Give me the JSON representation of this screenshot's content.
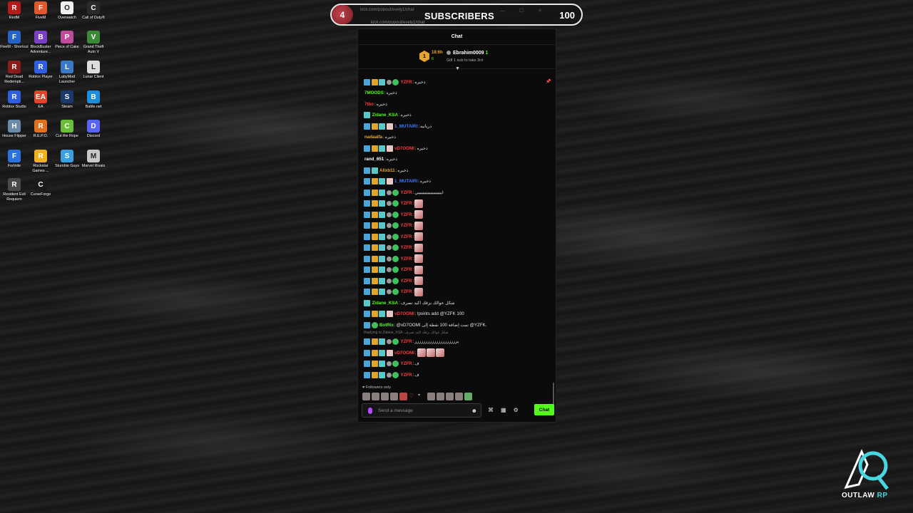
{
  "desktop_icons": [
    {
      "label": "RedM",
      "icon": "redm-icon",
      "color": "#b41c1c",
      "glyph": "R"
    },
    {
      "label": "FiveM",
      "icon": "fivem-icon",
      "color": "#e0592a",
      "glyph": "F"
    },
    {
      "label": "Overwatch",
      "icon": "overwatch-icon",
      "color": "#f0f0f0",
      "glyph": "O"
    },
    {
      "label": "Call of Duty®",
      "icon": "call-of-duty-icon",
      "color": "#2a2a2a",
      "glyph": "C"
    },
    {
      "label": "FiveM - Shortcut",
      "icon": "fivem-shortcut-icon",
      "color": "#2264c7",
      "glyph": "F"
    },
    {
      "label": "BlockBuster Adventure...",
      "icon": "blockbuster-icon",
      "color": "#7a3fc4",
      "glyph": "B"
    },
    {
      "label": "Piece of Cake",
      "icon": "piece-of-cake-icon",
      "color": "#c04a9b",
      "glyph": "P"
    },
    {
      "label": "Grand Theft Auto V",
      "icon": "gta-icon",
      "color": "#3a8a3a",
      "glyph": "V"
    },
    {
      "label": "Red Dead Redempti...",
      "icon": "red-dead-icon",
      "color": "#8c1b1b",
      "glyph": "R"
    },
    {
      "label": "Roblox Player",
      "icon": "roblox-player-icon",
      "color": "#2f5fe0",
      "glyph": "R"
    },
    {
      "label": "LabyMod Launcher",
      "icon": "labymod-icon",
      "color": "#3a78c8",
      "glyph": "L"
    },
    {
      "label": "Lunar Client",
      "icon": "lunar-client-icon",
      "color": "#dcdcdc",
      "glyph": "L"
    },
    {
      "label": "Roblox Studio",
      "icon": "roblox-studio-icon",
      "color": "#2f5fe0",
      "glyph": "R"
    },
    {
      "label": "EA",
      "icon": "ea-icon",
      "color": "#e0452a",
      "glyph": "EA"
    },
    {
      "label": "Steam",
      "icon": "steam-icon",
      "color": "#1b3a6b",
      "glyph": "S"
    },
    {
      "label": "Battle.net",
      "icon": "battlenet-icon",
      "color": "#1c8ee0",
      "glyph": "B"
    },
    {
      "label": "House Flipper",
      "icon": "house-flipper-icon",
      "color": "#6a8aa8",
      "glyph": "H"
    },
    {
      "label": "R.E.P.O.",
      "icon": "repo-icon",
      "color": "#e07020",
      "glyph": "R"
    },
    {
      "label": "Cut the Rope",
      "icon": "cut-the-rope-icon",
      "color": "#6abf3a",
      "glyph": "C"
    },
    {
      "label": "Discord",
      "icon": "discord-icon",
      "color": "#5865f2",
      "glyph": "D"
    },
    {
      "label": "Fortnite",
      "icon": "fortnite-icon",
      "color": "#2a72e0",
      "glyph": "F"
    },
    {
      "label": "Rockstar Games ...",
      "icon": "rockstar-icon",
      "color": "#f0b020",
      "glyph": "R"
    },
    {
      "label": "Stumble Guys",
      "icon": "stumble-guys-icon",
      "color": "#3aa0e0",
      "glyph": "S"
    },
    {
      "label": "Marvel Rivals",
      "icon": "marvel-rivals-icon",
      "color": "#c8c8c8",
      "glyph": "M"
    },
    {
      "label": "Resident Evil Requiem",
      "icon": "resident-evil-icon",
      "color": "#4a4a4a",
      "glyph": "R"
    },
    {
      "label": "CurseForge",
      "icon": "curseforge-icon",
      "color": "#1a1a1a",
      "glyph": "C"
    }
  ],
  "subscribers": {
    "count": "4",
    "label": "SUBSCRIBERS",
    "goal": "100",
    "url": "kick.com/popout/evely1/chat",
    "url_bar": "kick.com/popout/evely1/chat"
  },
  "chat": {
    "title": "Chat",
    "pinned": {
      "rank": "1",
      "time": "18:6h",
      "sub_count": "6",
      "user": "Ebrahim0009",
      "user_badge": "1",
      "gift_text": "Gift 1 sub to take 3rd"
    },
    "messages": [
      {
        "badges": [
          "blue",
          "gold",
          "teal",
          "gray",
          "green"
        ],
        "user": "YZFR",
        "color": "#ff3b3b",
        "text": "ذخيره"
      },
      {
        "badges": [],
        "user": "7MOODS",
        "color": "#53fc18",
        "text": "ذخيره"
      },
      {
        "badges": [],
        "user": "7tbo",
        "color": "#ff3b3b",
        "text": "ذخيره"
      },
      {
        "badges": [
          "teal"
        ],
        "user": "Zidane_KSA",
        "color": "#53fc18",
        "text": "ذخيره"
      },
      {
        "badges": [
          "blue",
          "gold",
          "teal",
          "pink"
        ],
        "user": "1_MUTAIRI",
        "color": "#3a7bff",
        "text": "ذريانيه"
      },
      {
        "badges": [],
        "user": "nadaalfa",
        "color": "#e4a62f",
        "text": "ذخيره"
      },
      {
        "badges": [
          "blue",
          "gold",
          "teal",
          "pink"
        ],
        "user": "vD7OOMI",
        "color": "#ff3b3b",
        "text": "ذخيره"
      },
      {
        "badges": [],
        "user": "rand_651",
        "color": "#ffffff",
        "text": "ذخيره"
      },
      {
        "badges": [
          "blue",
          "teal"
        ],
        "user": "Alixb11",
        "color": "#e4a62f",
        "text": "ذخيره"
      },
      {
        "badges": [
          "blue",
          "gold",
          "teal",
          "pink"
        ],
        "user": "1_MUTAIRI",
        "color": "#3a7bff",
        "text": "ذخيره"
      },
      {
        "badges": [
          "blue",
          "gold",
          "teal",
          "gray",
          "green"
        ],
        "user": "YZFR",
        "color": "#ff3b3b",
        "text": "اييييييييييييييييييي"
      },
      {
        "badges": [
          "blue",
          "gold",
          "teal",
          "gray",
          "green"
        ],
        "user": "YZFR",
        "color": "#ff3b3b",
        "text": "",
        "emote": true
      },
      {
        "badges": [
          "blue",
          "gold",
          "teal",
          "gray",
          "green"
        ],
        "user": "YZFR",
        "color": "#ff3b3b",
        "text": "",
        "emote": true
      },
      {
        "badges": [
          "blue",
          "gold",
          "teal",
          "gray",
          "green"
        ],
        "user": "YZFR",
        "color": "#ff3b3b",
        "text": "",
        "emote": true
      },
      {
        "badges": [
          "blue",
          "gold",
          "teal",
          "gray",
          "green"
        ],
        "user": "YZFR",
        "color": "#ff3b3b",
        "text": "",
        "emote": true
      },
      {
        "badges": [
          "blue",
          "gold",
          "teal",
          "gray",
          "green"
        ],
        "user": "YZFR",
        "color": "#ff3b3b",
        "text": "",
        "emote": true
      },
      {
        "badges": [
          "blue",
          "gold",
          "teal",
          "gray",
          "green"
        ],
        "user": "YZFR",
        "color": "#ff3b3b",
        "text": "",
        "emote": true
      },
      {
        "badges": [
          "blue",
          "gold",
          "teal",
          "gray",
          "green"
        ],
        "user": "YZFR",
        "color": "#ff3b3b",
        "text": "",
        "emote": true
      },
      {
        "badges": [
          "blue",
          "gold",
          "teal",
          "gray",
          "green"
        ],
        "user": "YZFR",
        "color": "#ff3b3b",
        "text": "",
        "emote": true
      },
      {
        "badges": [
          "blue",
          "gold",
          "teal",
          "gray",
          "green"
        ],
        "user": "YZFR",
        "color": "#ff3b3b",
        "text": "",
        "emote": true
      },
      {
        "badges": [
          "teal"
        ],
        "user": "Zidane_KSA",
        "color": "#53fc18",
        "text": "شكل عوالك بزقك اكيد تصرف"
      },
      {
        "badges": [
          "blue",
          "gold",
          "teal",
          "pink"
        ],
        "user": "vD7OOMI",
        "color": "#ff3b3b",
        "text": "!points add @YZFK 100"
      },
      {
        "badges": [
          "blue",
          "green"
        ],
        "user": "BotRix",
        "color": "#53fc18",
        "text": "@vD7OOMI تمت إضافة 100 نقطة إلى @YZFK."
      },
      {
        "badges": [
          "blue",
          "gold",
          "teal",
          "gray",
          "green"
        ],
        "user": "YZFR",
        "color": "#ff3b3b",
        "text": "يزززززززززززززززززززز",
        "reply": "Replying to Zidane_KSA: شكل عوالك بزقك اكيد تصرف"
      },
      {
        "badges": [
          "blue",
          "gold",
          "teal",
          "pink"
        ],
        "user": "vD7OOMI",
        "color": "#ff3b3b",
        "text": "",
        "emote3": true
      },
      {
        "badges": [
          "blue",
          "gold",
          "teal",
          "gray",
          "green"
        ],
        "user": "YZFR",
        "color": "#ff3b3b",
        "text": "ف"
      },
      {
        "badges": [
          "blue",
          "gold",
          "teal",
          "gray",
          "green"
        ],
        "user": "YZFR",
        "color": "#ff3b3b",
        "text": "ف"
      }
    ],
    "followers_only": "Followers only",
    "input_placeholder": "Send a message",
    "send_label": "Chat"
  },
  "logo": {
    "word1": "OUTLAW",
    "word2": "RP"
  }
}
